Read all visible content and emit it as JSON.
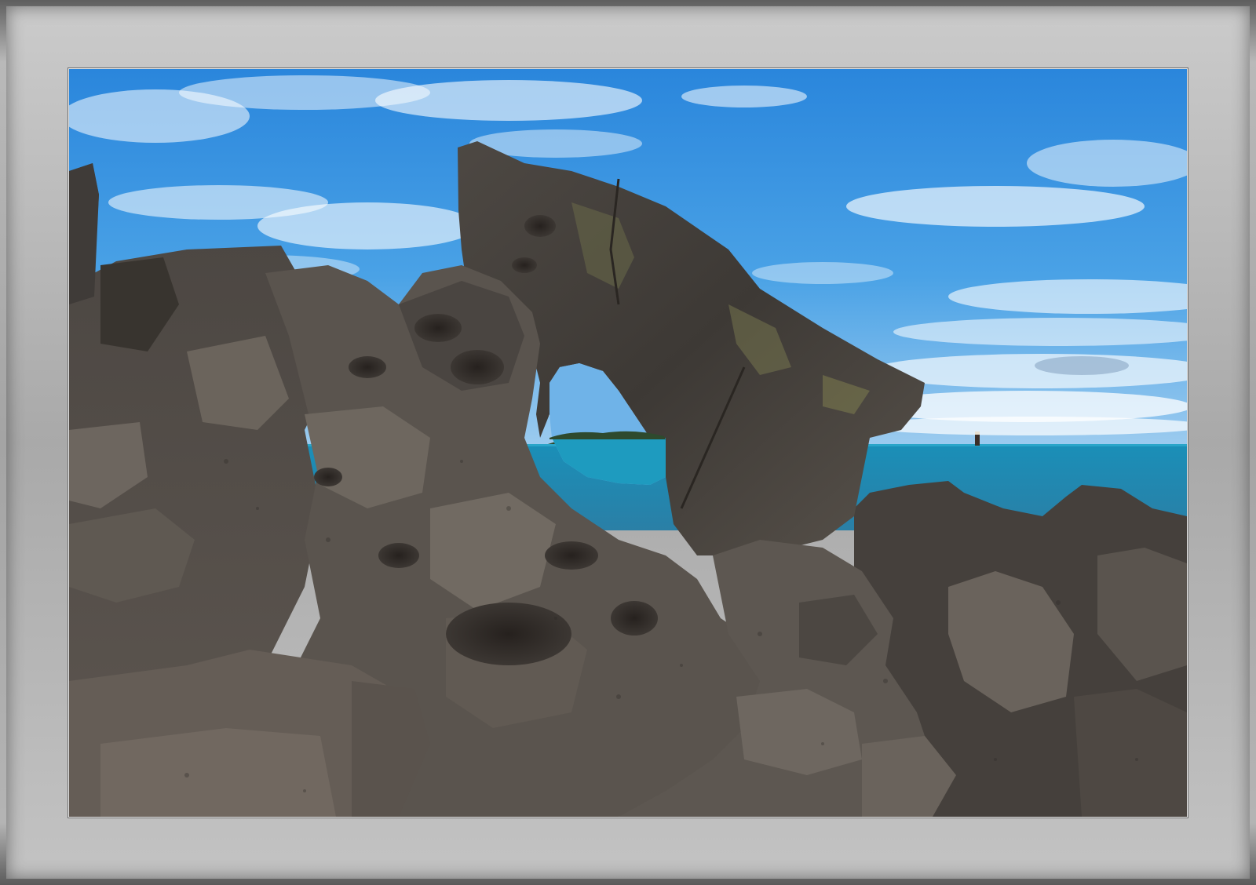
{
  "scene": {
    "subject": "volcanic-rock-arch",
    "colors": {
      "sky_top": "#2f8de0",
      "sky_bottom": "#7ec0ee",
      "sea": "#1e9bbf",
      "sea_near": "#2bb0c9",
      "rock_dark": "#3c3936",
      "rock_mid": "#5e5954",
      "rock_light": "#7d766e",
      "lichen": "#8a8a52",
      "mat_light": "#c8c8c8",
      "mat_dark": "#5e5e5e"
    }
  }
}
